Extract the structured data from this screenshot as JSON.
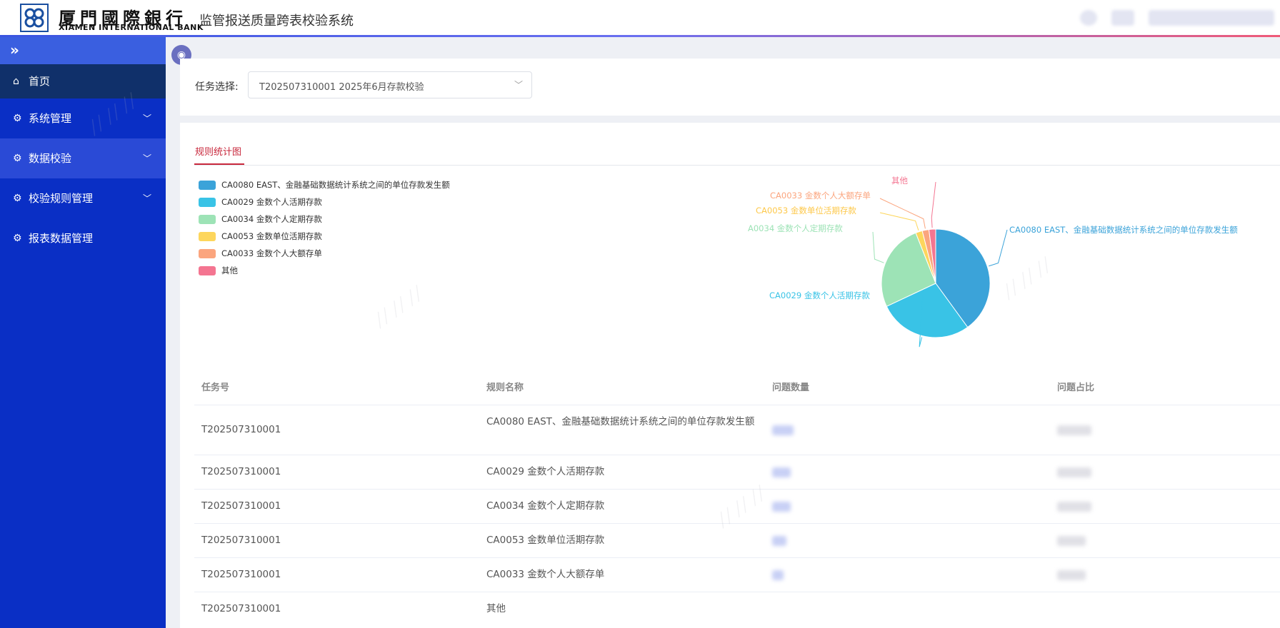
{
  "header": {
    "bank_name_cn": "厦門國際銀行",
    "bank_name_en": "XIAMEN INTERNATIONAL BANK",
    "system_title": "监管报送质量跨表校验系统"
  },
  "sidebar": {
    "collapse_icon": "double-chevron-right-icon",
    "items": [
      {
        "label": "首页",
        "icon": "home-icon"
      },
      {
        "label": "系统管理",
        "icon": "gear-icon"
      },
      {
        "label": "数据校验",
        "icon": "gear-icon"
      },
      {
        "label": "校验规则管理",
        "icon": "gear-icon"
      },
      {
        "label": "报表数据管理",
        "icon": "gear-icon"
      }
    ]
  },
  "task_select": {
    "label": "任务选择:",
    "value": "T202507310001 2025年6月存款校验"
  },
  "tab": {
    "label": "规则统计图"
  },
  "colors": {
    "accent": "#c8283c",
    "sidebar": "#0a2fc5",
    "series": [
      "#3ba3d9",
      "#39c3e6",
      "#9de3b6",
      "#fdd65c",
      "#fba57e",
      "#f47591"
    ]
  },
  "chart_data": {
    "type": "pie",
    "legend": [
      "CA0080 EAST、金融基础数据统计系统之间的单位存款发生额",
      "CA0029 金数个人活期存款",
      "CA0034 金数个人定期存款",
      "CA0053 金数单位活期存款",
      "CA0033 金数个人大额存单",
      "其他"
    ],
    "slice_labels": [
      "CA0080 EAST、金融基础数据统计系统之间的单位存款发生额",
      "CA0029 金数个人活期存款",
      "A0034 金数个人定期存款",
      "CA0053 金数单位活期存款",
      "CA0033 金数个人大额存单",
      "其他"
    ],
    "values": [
      40,
      28,
      26,
      2,
      2,
      2
    ],
    "legend_position": "top-left"
  },
  "table": {
    "columns": [
      "任务号",
      "规则名称",
      "问题数量",
      "问题占比"
    ],
    "rows": [
      {
        "task": "T202507310001",
        "rule": "CA0080 EAST、金融基础数据统计系统之间的单位存款发生额"
      },
      {
        "task": "T202507310001",
        "rule": "CA0029 金数个人活期存款"
      },
      {
        "task": "T202507310001",
        "rule": "CA0034 金数个人定期存款"
      },
      {
        "task": "T202507310001",
        "rule": "CA0053 金数单位活期存款"
      },
      {
        "task": "T202507310001",
        "rule": "CA0033 金数个人大额存单"
      },
      {
        "task": "T202507310001",
        "rule": "其他"
      }
    ]
  }
}
